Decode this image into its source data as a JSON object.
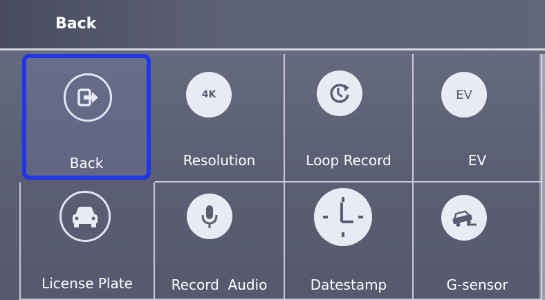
{
  "header": {
    "title": "Back"
  },
  "menu": {
    "row1": [
      {
        "label": "Back",
        "icon": "exit-icon"
      },
      {
        "label": "Resolution",
        "icon_text": "4K"
      },
      {
        "label": "Loop Record",
        "icon": "loop-record-icon"
      },
      {
        "label": "EV",
        "icon_text": "EV"
      }
    ],
    "row2": [
      {
        "label": "License Plate",
        "icon": "car-icon"
      },
      {
        "label": "Record  Audio",
        "icon": "microphone-icon"
      },
      {
        "label": "Datestamp",
        "icon": "clock-icon"
      },
      {
        "label": "G-sensor",
        "icon": "g-sensor-icon"
      }
    ]
  },
  "colors": {
    "selection": "#1f37e6",
    "icon_circle": "#e9ebf3",
    "background": "#5f6378"
  }
}
